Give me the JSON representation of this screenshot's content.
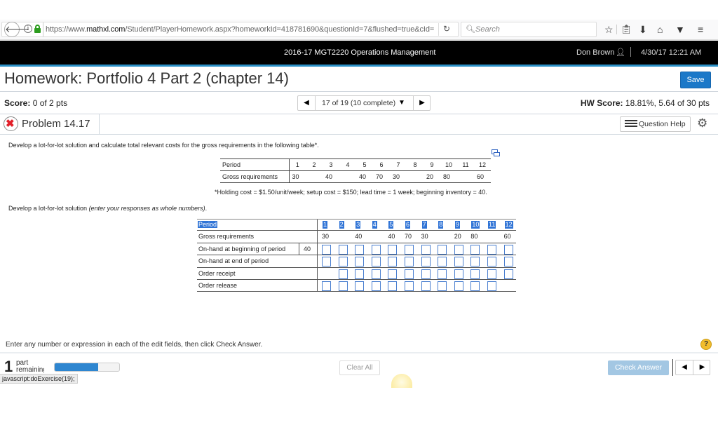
{
  "browser": {
    "url_prefix": "https://www.",
    "url_domain": "mathxl.com",
    "url_rest": "/Student/PlayerHomework.aspx?homeworkId=418781690&questionId=7&flushed=true&cId=",
    "search_placeholder": "Search",
    "icons": [
      "back-arrow-icon",
      "info-icon",
      "lock-icon",
      "reload-icon",
      "search-icon",
      "star-icon",
      "clipboard-icon",
      "download-icon",
      "home-icon",
      "pocket-icon",
      "menu-icon"
    ]
  },
  "header": {
    "course": "2016-17 MGT2220 Operations Management",
    "user": "Don Brown",
    "datetime": "4/30/17 12:21 AM"
  },
  "title_row": {
    "title": "Homework: Portfolio 4 Part 2 (chapter 14)",
    "save_label": "Save"
  },
  "score_row": {
    "score_label": "Score:",
    "score_value": "0 of 2 pts",
    "nav_label": "17 of 19 (10 complete)",
    "hw_score_label": "HW Score:",
    "hw_score_value": "18.81%, 5.64 of 30 pts"
  },
  "problem_row": {
    "status": "incorrect",
    "title": "Problem 14.17",
    "help_label": "Question Help"
  },
  "question": {
    "intro": "Develop a lot-for-lot solution and calculate total relevant costs for the gross requirements in the following table*.",
    "given_table": {
      "row_labels": [
        "Period",
        "Gross requirements"
      ],
      "periods": [
        "1",
        "2",
        "3",
        "4",
        "5",
        "6",
        "7",
        "8",
        "9",
        "10",
        "11",
        "12"
      ],
      "gross_requirements": [
        "30",
        "",
        "40",
        "",
        "40",
        "70",
        "30",
        "",
        "20",
        "80",
        "",
        "60"
      ]
    },
    "footnote": "*Holding cost = $1.50/unit/week; setup cost = $150; lead time = 1 week; beginning inventory = 40.",
    "instruction_prefix": "Develop a lot-for-lot solution ",
    "instruction_italic": "(enter your responses as whole numbers)",
    "instruction_suffix": "."
  },
  "answer_table": {
    "rows": [
      {
        "label": "Period"
      },
      {
        "label": "Gross requirements"
      },
      {
        "label": "On-hand at beginning of period",
        "initial": "40"
      },
      {
        "label": "On-hand at end of period"
      },
      {
        "label": "Order receipt"
      },
      {
        "label": "Order release"
      }
    ],
    "periods": [
      "1",
      "2",
      "3",
      "4",
      "5",
      "6",
      "7",
      "8",
      "9",
      "10",
      "11",
      "12"
    ],
    "gross_requirements": [
      "30",
      "",
      "40",
      "",
      "40",
      "70",
      "30",
      "",
      "20",
      "80",
      "",
      "60"
    ],
    "inputs": {
      "on_hand_begin": [
        "",
        "",
        "",
        "",
        "",
        "",
        "",
        "",
        "",
        "",
        "",
        ""
      ],
      "on_hand_end": [
        "",
        "",
        "",
        "",
        "",
        "",
        "",
        "",
        "",
        "",
        "",
        ""
      ],
      "order_receipt": [
        null,
        "",
        "",
        "",
        "",
        "",
        "",
        "",
        "",
        "",
        "",
        ""
      ],
      "order_release": [
        "",
        "",
        "",
        "",
        "",
        "",
        "",
        "",
        "",
        "",
        "",
        null
      ]
    }
  },
  "footer": {
    "hint": "Enter any number or expression in each of the edit fields, then click Check Answer.",
    "help_symbol": "?",
    "parts_count": "1",
    "parts_label": "part remaining",
    "progress_fraction": 0.67,
    "status_bar": "javascript:doExercise(19);",
    "clear_label": "Clear All",
    "check_label": "Check Answer"
  },
  "colors": {
    "accent": "#2a8fc5",
    "save_button": "#1b78c8",
    "incorrect": "#e2202a",
    "selection": "#3074d6",
    "check_disabled": "#a3c7e3"
  }
}
